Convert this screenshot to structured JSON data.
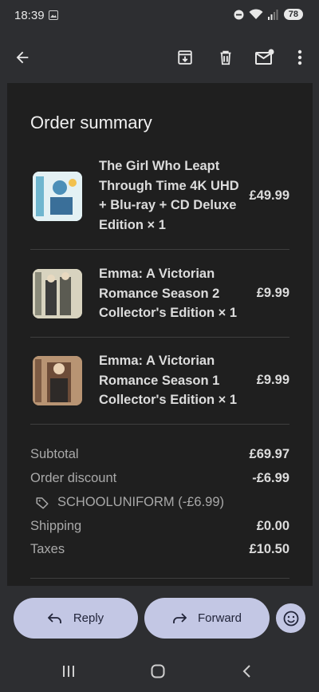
{
  "status": {
    "time": "18:39",
    "battery": "78"
  },
  "app_bar": {
    "back_icon": "arrow-back-icon",
    "actions": [
      "archive-icon",
      "delete-icon",
      "mark-unread-icon",
      "more-vert-icon"
    ]
  },
  "order": {
    "title": "Order summary",
    "items": [
      {
        "name": "The Girl Who Leapt Through Time 4K UHD + Blu-ray + CD Deluxe Edition × 1",
        "price": "£49.99"
      },
      {
        "name": "Emma: A Victorian Romance Season 2 Collector's Edition × 1",
        "price": "£9.99"
      },
      {
        "name": "Emma: A Victorian Romance Season 1 Collector's Edition × 1",
        "price": "£9.99"
      }
    ],
    "totals": {
      "subtotal_label": "Subtotal",
      "subtotal": "£69.97",
      "discount_label": "Order discount",
      "discount": "-£6.99",
      "coupon": "SCHOOLUNIFORM (-£6.99)",
      "shipping_label": "Shipping",
      "shipping": "£0.00",
      "taxes_label": "Taxes",
      "taxes": "£10.50"
    }
  },
  "actions": {
    "reply": "Reply",
    "forward": "Forward"
  },
  "colors": {
    "background": "#2d2e31",
    "card": "#1f1f1f",
    "pill": "#c3c7e4"
  }
}
